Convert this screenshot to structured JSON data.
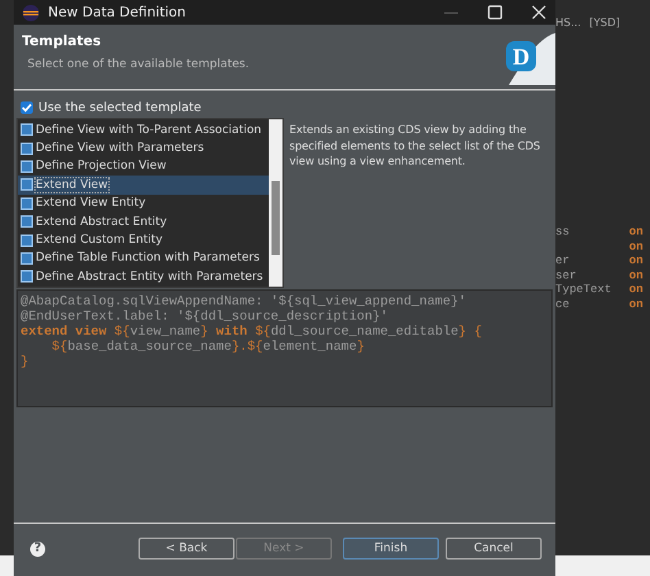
{
  "window": {
    "title": "New Data Definition"
  },
  "background_editor": {
    "tabs": [
      {
        "label": "HS..."
      },
      {
        "label": "[YSD]"
      }
    ],
    "lines": [
      {
        "text": "ss",
        "keyword": "on"
      },
      {
        "keyword": "on"
      },
      {
        "text": "er",
        "keyword": "on"
      },
      {
        "text": "ser",
        "keyword": "on"
      },
      {
        "text": "TypeText",
        "keyword": "on"
      },
      {
        "text": "ce",
        "keyword": "on"
      }
    ]
  },
  "header": {
    "title": "Templates",
    "subtitle": "Select one of the available templates.",
    "logo_letter": "D"
  },
  "use_template": {
    "label": "Use the selected template",
    "checked": true
  },
  "templates": [
    {
      "label": "Define View with To-Parent Association",
      "selected": false
    },
    {
      "label": "Define View with Parameters",
      "selected": false
    },
    {
      "label": "Define Projection View",
      "selected": false
    },
    {
      "label": "Extend View",
      "selected": true
    },
    {
      "label": "Extend View Entity",
      "selected": false
    },
    {
      "label": "Extend Abstract Entity",
      "selected": false
    },
    {
      "label": "Extend Custom Entity",
      "selected": false
    },
    {
      "label": "Define Table Function with Parameters",
      "selected": false
    },
    {
      "label": "Define Abstract Entity with Parameters",
      "selected": false
    }
  ],
  "description": "Extends an existing CDS view by adding the specified elements to the select list of the CDS view using a view enhancement.",
  "preview": [
    [
      {
        "text": "@AbapCatalog.sqlViewAppendName: '${sql_view_append_name}'",
        "kind": "plain"
      }
    ],
    [
      {
        "text": "@EndUserText.label: '${ddl_source_description}'",
        "kind": "plain"
      }
    ],
    [
      {
        "text": "extend view ",
        "kind": "keyword"
      },
      {
        "text": "${",
        "kind": "var"
      },
      {
        "text": "view_name",
        "kind": "plain"
      },
      {
        "text": "} ",
        "kind": "var"
      },
      {
        "text": "with ",
        "kind": "keyword"
      },
      {
        "text": "${",
        "kind": "var"
      },
      {
        "text": "ddl_source_name_editable",
        "kind": "plain"
      },
      {
        "text": "} {",
        "kind": "var"
      }
    ],
    [
      {
        "text": "    ${",
        "kind": "var"
      },
      {
        "text": "base_data_source_name",
        "kind": "plain"
      },
      {
        "text": "}.${",
        "kind": "var"
      },
      {
        "text": "element_name",
        "kind": "plain"
      },
      {
        "text": "}",
        "kind": "var"
      }
    ],
    [
      {
        "text": "}",
        "kind": "var"
      }
    ]
  ],
  "help": {
    "label": "?"
  },
  "buttons": [
    {
      "label": "< Back",
      "disabled": false,
      "default": false
    },
    {
      "label": "Next >",
      "disabled": true,
      "default": false
    },
    {
      "label": "Finish",
      "disabled": false,
      "default": true
    },
    {
      "label": "Cancel",
      "disabled": false,
      "default": false
    }
  ]
}
